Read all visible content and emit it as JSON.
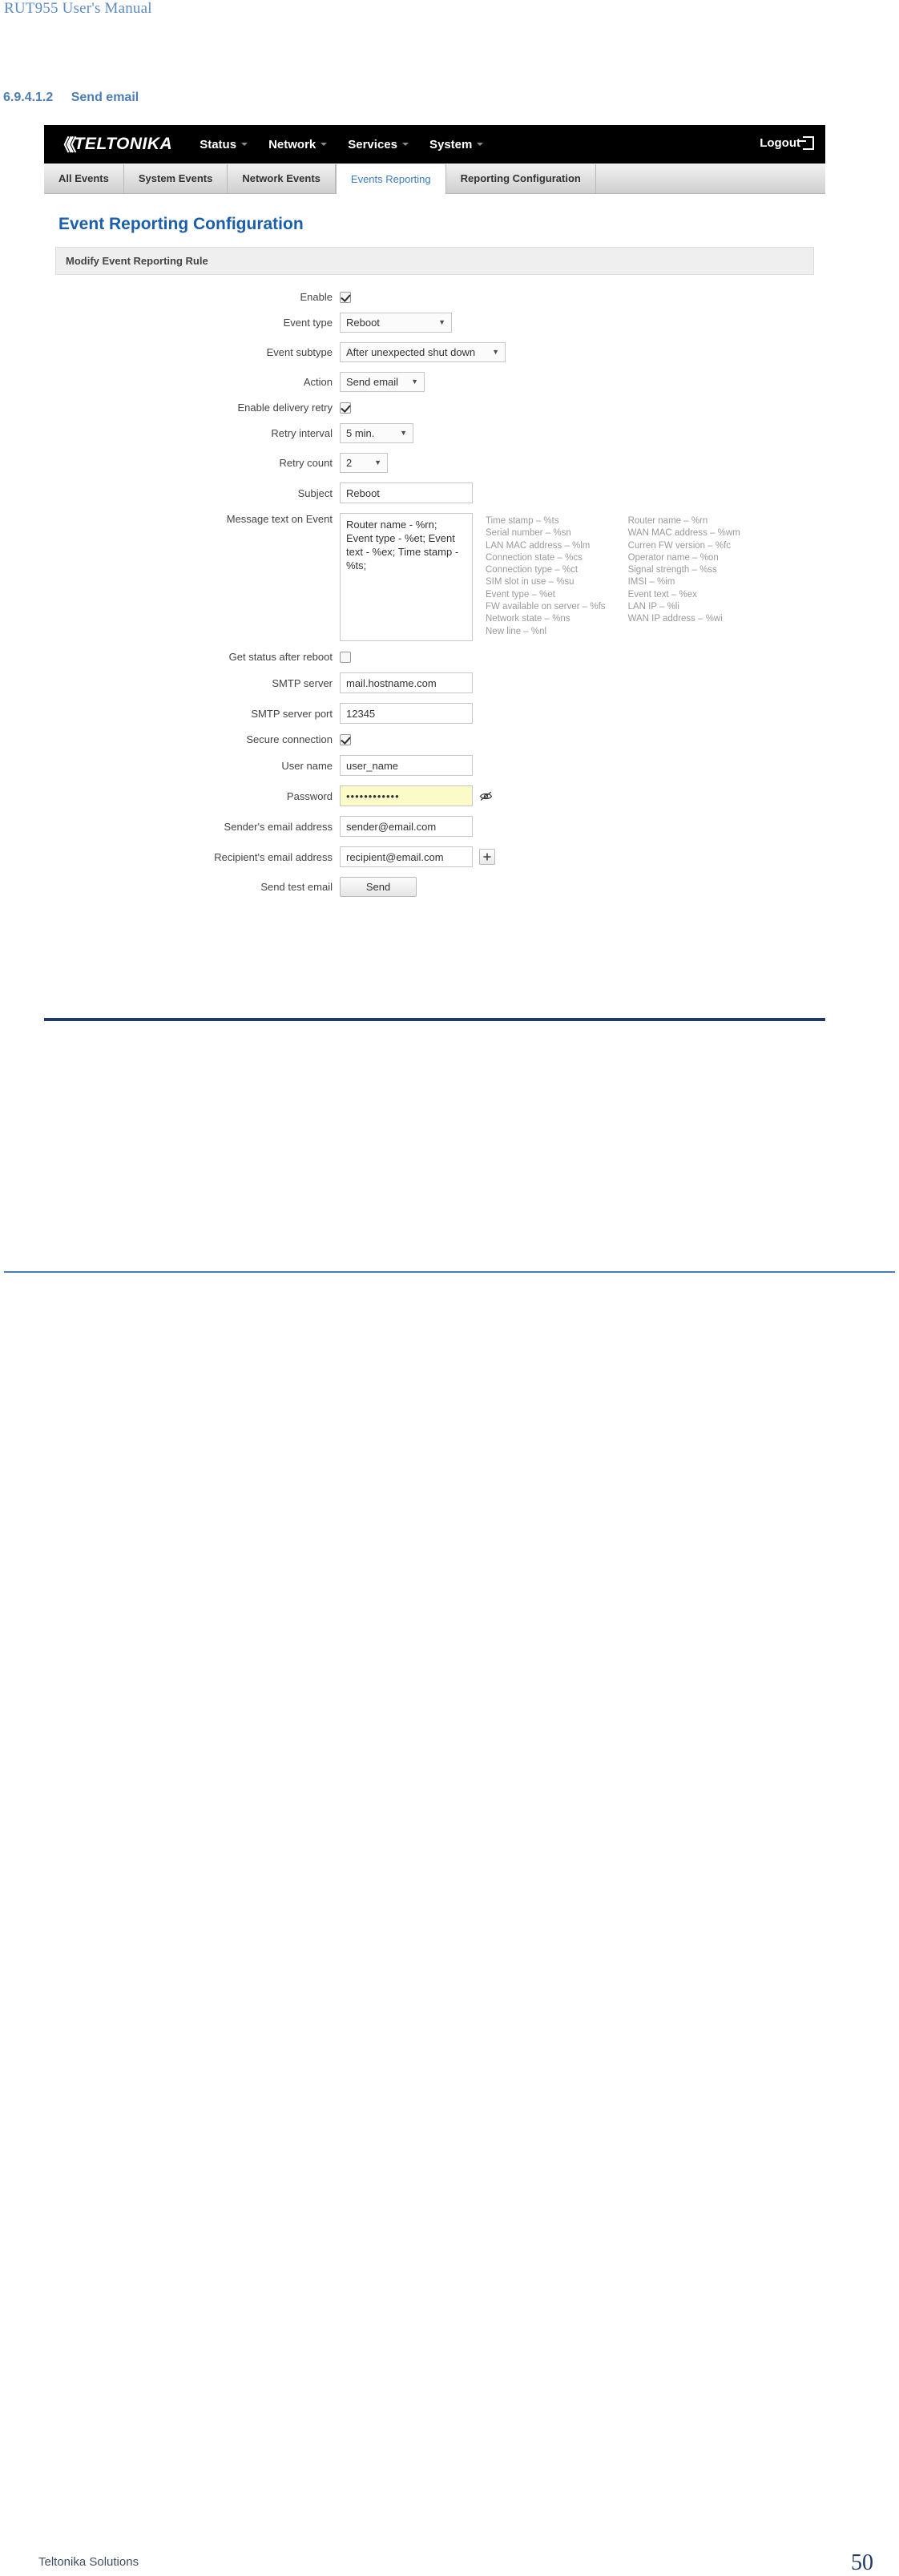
{
  "document": {
    "header_title": "RUT955 User's Manual",
    "section_number": "6.9.4.1.2",
    "section_title": "Send email",
    "footer_left": "Teltonika Solutions",
    "footer_page": "50"
  },
  "navbar": {
    "logo_mark": "《《",
    "logo_text": "TELTONIKA",
    "items": [
      {
        "label": "Status"
      },
      {
        "label": "Network"
      },
      {
        "label": "Services"
      },
      {
        "label": "System"
      }
    ],
    "logout_label": "Logout"
  },
  "tabs": [
    {
      "label": "All Events",
      "active": false
    },
    {
      "label": "System Events",
      "active": false
    },
    {
      "label": "Network Events",
      "active": false
    },
    {
      "label": "Events Reporting",
      "active": true
    },
    {
      "label": "Reporting Configuration",
      "active": false
    }
  ],
  "page": {
    "title": "Event Reporting Configuration",
    "panel_title": "Modify Event Reporting Rule"
  },
  "form": {
    "enable_label": "Enable",
    "enable_checked": "on",
    "event_type_label": "Event type",
    "event_type_value": "Reboot",
    "event_subtype_label": "Event subtype",
    "event_subtype_value": "After unexpected shut down",
    "action_label": "Action",
    "action_value": "Send email",
    "delivery_retry_label": "Enable delivery retry",
    "retry_interval_label": "Retry interval",
    "retry_interval_value": "5 min.",
    "retry_count_label": "Retry count",
    "retry_count_value": "2",
    "subject_label": "Subject",
    "subject_value": "Reboot",
    "message_label": "Message text on Event",
    "message_value": "Router name - %rn; Event type - %et; Event text - %ex; Time stamp - %ts;",
    "get_status_label": "Get status after reboot",
    "smtp_server_label": "SMTP server",
    "smtp_server_value": "mail.hostname.com",
    "smtp_port_label": "SMTP server port",
    "smtp_port_value": "12345",
    "secure_connection_label": "Secure connection",
    "user_name_label": "User name",
    "user_name_value": "user_name",
    "password_label": "Password",
    "password_value": "••••••••••••",
    "sender_label": "Sender's email address",
    "sender_value": "sender@email.com",
    "recipient_label": "Recipient's email address",
    "recipient_value": "recipient@email.com",
    "add_recipient_label": "➕",
    "send_test_label": "Send test email",
    "send_button_label": "Send"
  },
  "help": {
    "column_middle": [
      "Time stamp – %ts",
      "Serial number – %sn",
      "LAN MAC address – %lm",
      "Connection state – %cs",
      "Connection type – %ct",
      "SIM slot in use – %su",
      "Event type – %et",
      "FW available on server – %fs",
      "Network state – %ns",
      "New line – %nl"
    ],
    "column_right": [
      "Router name – %rn",
      "WAN MAC address – %wm",
      "Curren FW version – %fc",
      "Operator name – %on",
      "Signal strength – %ss",
      "IMSI – %im",
      "Event text – %ex",
      "LAN IP – %li",
      "WAN IP address – %wi"
    ]
  },
  "colors": {
    "doc_blue": "#4a7db5",
    "title_blue": "#1b5faa",
    "tab_active": "#3b7bbf",
    "navbar_bg": "#000000",
    "password_bg": "#fbfbc8"
  }
}
